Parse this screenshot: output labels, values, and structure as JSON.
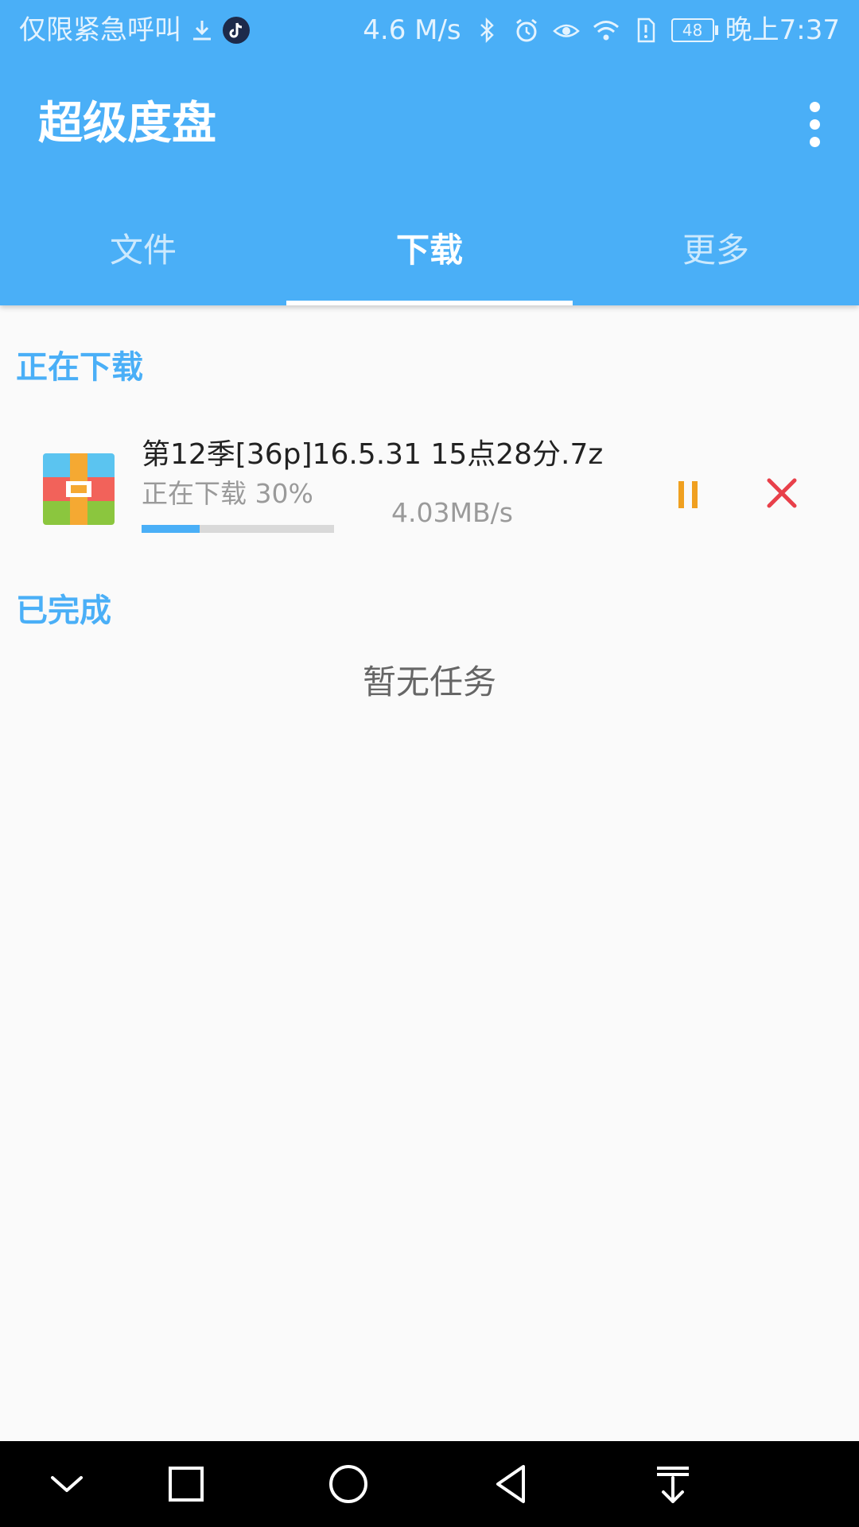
{
  "status_bar": {
    "carrier_text": "仅限紧急呼叫",
    "net_speed": "4.6 M/s",
    "battery": "48",
    "time": "晚上7:37",
    "icons": [
      "download-icon",
      "tiktok-icon",
      "bluetooth-icon",
      "alarm-icon",
      "eye-icon",
      "wifi-icon",
      "sim-alert-icon",
      "battery-icon"
    ]
  },
  "toolbar": {
    "title": "超级度盘",
    "menu_icon": "more-vertical-icon"
  },
  "tabs": [
    {
      "label": "文件",
      "active": false
    },
    {
      "label": "下载",
      "active": true
    },
    {
      "label": "更多",
      "active": false
    }
  ],
  "downloading": {
    "section_title": "正在下载",
    "items": [
      {
        "file_name": "第12季[36p]16.5.31 15点28分.7z",
        "status": "正在下载 30%",
        "progress": 0.3,
        "speed": "4.03MB/s",
        "file_icon": "archive-icon",
        "pause_icon": "pause-icon",
        "cancel_icon": "close-icon"
      }
    ]
  },
  "completed": {
    "section_title": "已完成",
    "empty_text": "暂无任务"
  },
  "navigation_bar": {
    "icons": [
      "collapse-icon",
      "recents-icon",
      "home-icon",
      "back-icon",
      "notification-pull-icon"
    ]
  },
  "colors": {
    "primary": "#4aaff7",
    "pause": "#f0a020",
    "cancel": "#e8404a"
  }
}
